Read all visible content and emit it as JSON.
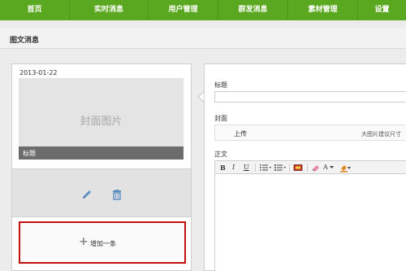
{
  "nav": {
    "items": [
      {
        "label": "首页"
      },
      {
        "label": "实时消息"
      },
      {
        "label": "用户管理"
      },
      {
        "label": "群发消息"
      },
      {
        "label": "素材管理"
      },
      {
        "label": "设置"
      }
    ]
  },
  "section": {
    "title": "图文消息"
  },
  "preview": {
    "date": "2013-01-22",
    "cover_text": "封面图片",
    "title_label": "标题",
    "add_label": "增加一条"
  },
  "editor": {
    "title_label": "标题",
    "title_value": "",
    "cover_label": "封面",
    "upload_label": "上传",
    "upload_hint": "大图片建议尺寸",
    "body_label": "正文",
    "toolbar": {
      "bold": "B",
      "italic": "I",
      "underline": "U",
      "font_color": "A"
    }
  },
  "colors": {
    "nav_green": "#5aa81f",
    "highlight_red": "#c01010"
  },
  "icons": [
    "edit-icon",
    "delete-icon",
    "plus-icon",
    "ordered-list-icon",
    "unordered-list-icon",
    "image-icon",
    "eraser-icon",
    "font-color-icon",
    "background-color-icon"
  ]
}
